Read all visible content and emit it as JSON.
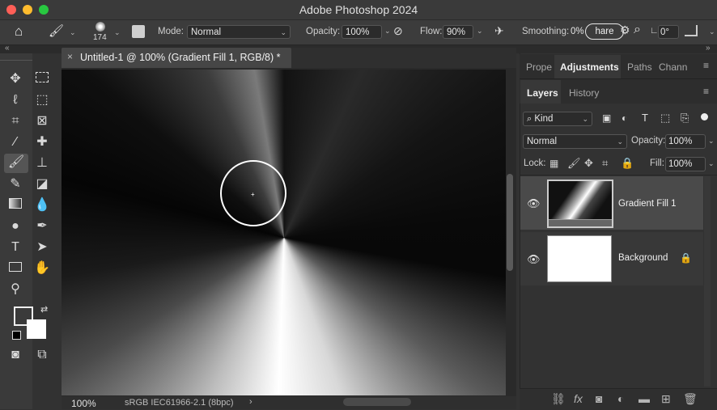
{
  "window": {
    "title": "Adobe Photoshop 2024"
  },
  "options_bar": {
    "brush_size": "174",
    "mode_label": "Mode:",
    "mode_value": "Normal",
    "opacity_label": "Opacity:",
    "opacity_value": "100%",
    "flow_label": "Flow:",
    "flow_value": "90%",
    "smoothing_label": "Smoothing:",
    "smoothing_value": "0%",
    "share_label": "hare",
    "angle_value": "0°"
  },
  "document": {
    "tab_title": "Untitled-1 @ 100% (Gradient Fill 1, RGB/8) *",
    "zoom": "100%",
    "color_profile": "sRGB IEC61966-2.1 (8bpc)"
  },
  "panels": {
    "top_tabs": [
      "Prope",
      "Adjustments",
      "Paths",
      "Chann"
    ],
    "active_top_tab": "Adjustments",
    "layer_tabs": [
      "Layers",
      "History"
    ],
    "filter_kind": "Kind",
    "blend_mode": "Normal",
    "opacity_label": "Opacity:",
    "opacity_value": "100%",
    "lock_label": "Lock:",
    "fill_label": "Fill:",
    "fill_value": "100%",
    "layers": [
      {
        "name": "Gradient Fill 1",
        "selected": true
      },
      {
        "name": "Background",
        "locked": true
      }
    ]
  },
  "colors": {
    "accent": "#1473e6",
    "ui_dark": "#323232"
  }
}
